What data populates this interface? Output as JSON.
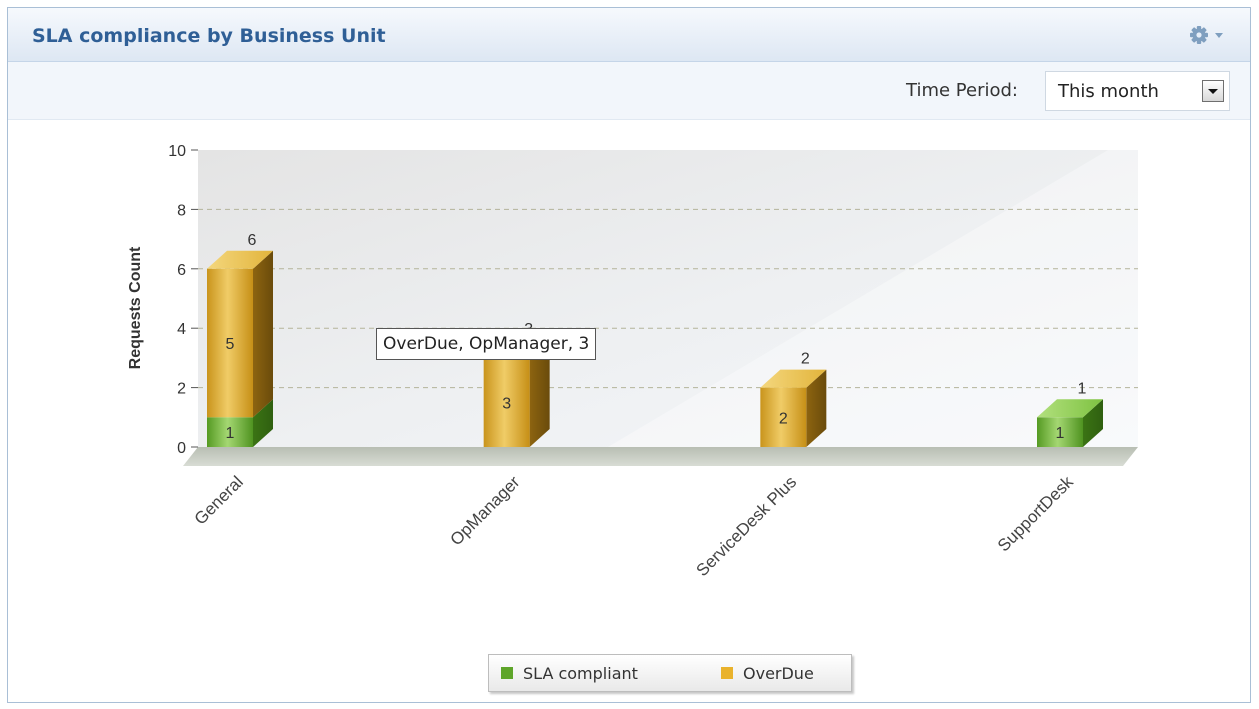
{
  "widget": {
    "title": "SLA compliance by Business Unit",
    "settings_icon": "gear-icon",
    "period_label": "Time Period:",
    "period_value": "This month",
    "dropdown_icon": "chevron-down-icon"
  },
  "tooltip": {
    "text": "OverDue, OpManager, 3"
  },
  "chart_data": {
    "type": "bar",
    "stacked": true,
    "three_d": true,
    "title": "",
    "xlabel": "",
    "ylabel": "Requests Count",
    "ylim": [
      0,
      10
    ],
    "yticks": [
      0,
      2,
      4,
      6,
      8,
      10
    ],
    "grid": true,
    "categories": [
      "General",
      "OpManager",
      "ServiceDesk Plus",
      "SupportDesk"
    ],
    "series": [
      {
        "name": "SLA compliant",
        "color": "#5ea52a",
        "values": [
          1,
          0,
          0,
          1
        ]
      },
      {
        "name": "OverDue",
        "color": "#e9b22c",
        "values": [
          5,
          3,
          2,
          0
        ]
      }
    ],
    "totals": [
      6,
      3,
      2,
      1
    ],
    "legend_position": "bottom-center"
  }
}
